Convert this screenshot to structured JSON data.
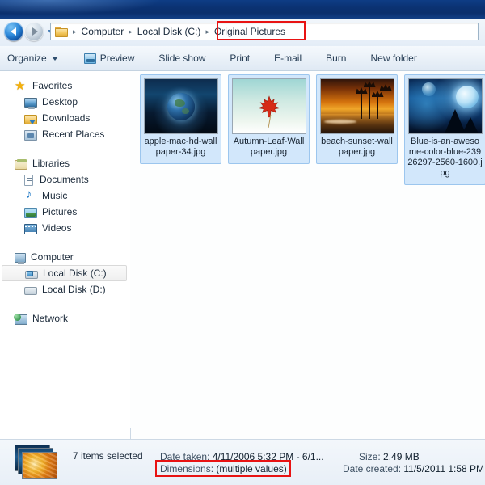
{
  "window": {
    "title_bar_color": "#0b3272"
  },
  "navigation": {
    "back_label": "Back",
    "forward_label": "Forward",
    "recent_pages_label": "Recent pages",
    "back_icon": "arrow-left-icon",
    "forward_icon": "arrow-right-icon",
    "dropdown_icon": "chevron-down-icon"
  },
  "breadcrumb": {
    "folder_icon": "folder-icon",
    "separator": "▸",
    "items": [
      {
        "label": "Computer",
        "highlighted": false
      },
      {
        "label": "Local Disk (C:)",
        "highlighted": false
      },
      {
        "label": "Original Pictures",
        "highlighted": true
      }
    ]
  },
  "toolbar": {
    "organize_label": "Organize",
    "preview_label": "Preview",
    "slideshow_label": "Slide show",
    "print_label": "Print",
    "email_label": "E-mail",
    "burn_label": "Burn",
    "newfolder_label": "New folder",
    "preview_icon": "preview-icon",
    "organize_caret_icon": "caret-down-icon"
  },
  "sidebar": {
    "groups": [
      {
        "header": {
          "label": "Favorites",
          "icon": "star-icon"
        },
        "items": [
          {
            "label": "Desktop",
            "icon": "desktop-icon"
          },
          {
            "label": "Downloads",
            "icon": "downloads-folder-icon"
          },
          {
            "label": "Recent Places",
            "icon": "recent-places-icon"
          }
        ]
      },
      {
        "header": {
          "label": "Libraries",
          "icon": "libraries-icon"
        },
        "items": [
          {
            "label": "Documents",
            "icon": "document-icon"
          },
          {
            "label": "Music",
            "icon": "music-note-icon"
          },
          {
            "label": "Pictures",
            "icon": "picture-icon"
          },
          {
            "label": "Videos",
            "icon": "video-icon"
          }
        ]
      },
      {
        "header": {
          "label": "Computer",
          "icon": "computer-icon"
        },
        "items": [
          {
            "label": "Local Disk (C:)",
            "icon": "system-drive-icon",
            "selected": true
          },
          {
            "label": "Local Disk (D:)",
            "icon": "hard-drive-icon",
            "selected": false
          }
        ]
      },
      {
        "header": {
          "label": "Network",
          "icon": "network-icon"
        },
        "items": []
      }
    ]
  },
  "files": [
    {
      "name": "apple-mac-hd-wallpaper-34.jpg",
      "selected": true,
      "thumbnail": "space-earth-thumbnail"
    },
    {
      "name": "Autumn-Leaf-Wallpaper.jpg",
      "selected": true,
      "thumbnail": "maple-leaf-thumbnail"
    },
    {
      "name": "beach-sunset-wallpaper.jpg",
      "selected": true,
      "thumbnail": "beach-sunset-thumbnail"
    },
    {
      "name": "Blue-is-an-awesome-color-blue-23926297-2560-1600.jpg",
      "selected": true,
      "thumbnail": "blue-moon-thumbnail"
    }
  ],
  "details_pane": {
    "icon": "stacked-photos-icon",
    "selection_count": "7 items selected",
    "date_taken_label": "Date taken:",
    "date_taken_value": "4/11/2006 5:32 PM - 6/1...",
    "dimensions_label": "Dimensions:",
    "dimensions_value": "(multiple values)",
    "size_label": "Size:",
    "size_value": "2.49 MB",
    "date_created_label": "Date created:",
    "date_created_value": "11/5/2011 1:58 PM"
  },
  "annotations": {
    "highlight_color": "#e81313",
    "boxes": [
      {
        "target": "breadcrumb-original-pictures"
      },
      {
        "target": "details-dimensions"
      }
    ]
  }
}
